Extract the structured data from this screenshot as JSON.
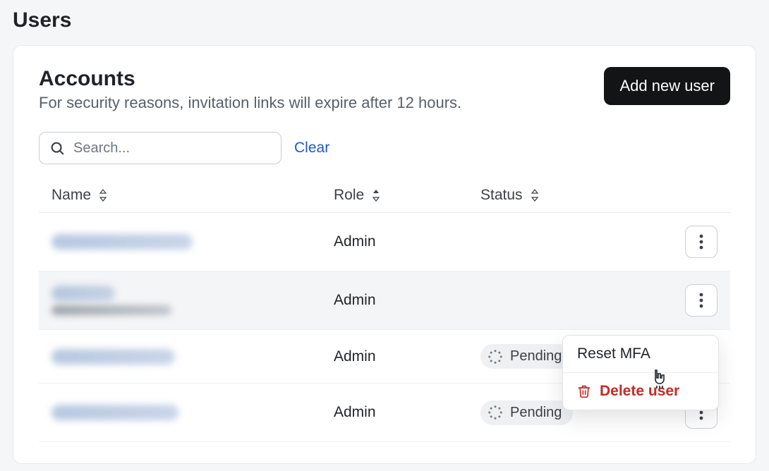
{
  "page": {
    "title": "Users"
  },
  "section": {
    "title": "Accounts",
    "subtitle": "For security reasons, invitation links will expire after 12 hours."
  },
  "actions": {
    "add_user_label": "Add new user",
    "clear_label": "Clear"
  },
  "search": {
    "placeholder": "Search..."
  },
  "columns": {
    "name": "Name",
    "role": "Role",
    "status": "Status"
  },
  "status_labels": {
    "pending": "Pending"
  },
  "rows": [
    {
      "role": "Admin",
      "status": null
    },
    {
      "role": "Admin",
      "status": null
    },
    {
      "role": "Admin",
      "status": "pending"
    },
    {
      "role": "Admin",
      "status": "pending"
    }
  ],
  "row_menu": {
    "reset_mfa": "Reset MFA",
    "delete_user": "Delete user"
  }
}
